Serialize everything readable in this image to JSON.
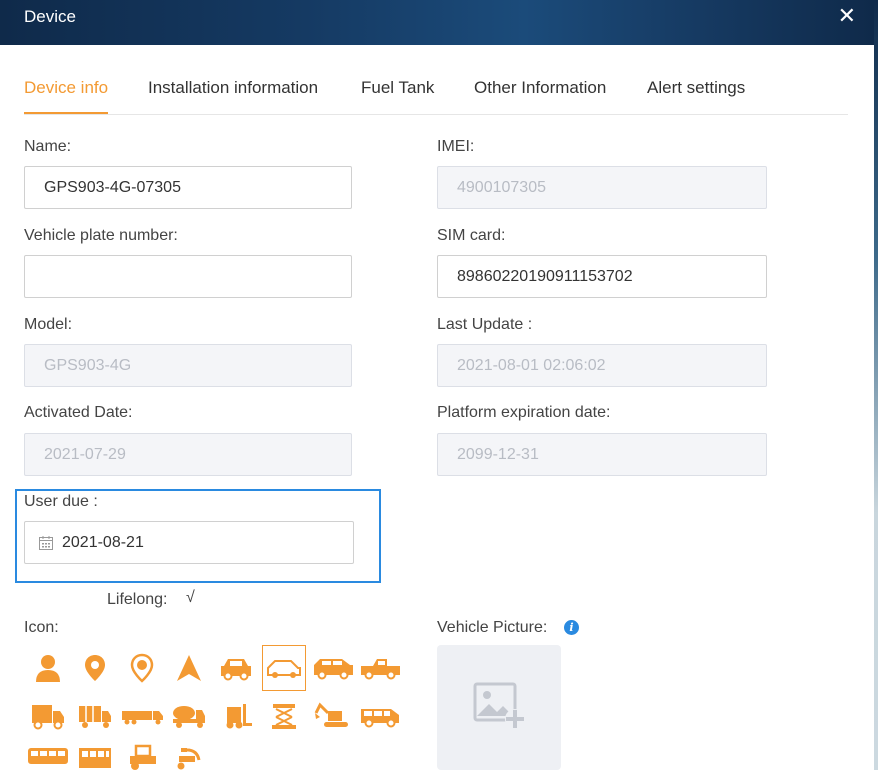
{
  "dialog": {
    "title": "Device"
  },
  "tabs": [
    {
      "label": "Device info"
    },
    {
      "label": "Installation information"
    },
    {
      "label": "Fuel Tank"
    },
    {
      "label": "Other Information"
    },
    {
      "label": "Alert settings"
    }
  ],
  "fields": {
    "name": {
      "label": "Name:",
      "value": "GPS903-4G-07305"
    },
    "imei": {
      "label": "IMEI:",
      "value": "4900107305"
    },
    "plate": {
      "label": "Vehicle plate number:",
      "value": ""
    },
    "sim": {
      "label": "SIM card:",
      "value": "89860220190911153702"
    },
    "model": {
      "label": "Model:",
      "value": "GPS903-4G"
    },
    "last_update": {
      "label": "Last Update :",
      "value": "2021-08-01 02:06:02"
    },
    "activated": {
      "label": "Activated Date:",
      "value": "2021-07-29"
    },
    "platform_exp": {
      "label": "Platform expiration date:",
      "value": "2099-12-31"
    },
    "user_due": {
      "label": "User due :",
      "value": "2021-08-21"
    }
  },
  "lifelong": {
    "label": "Lifelong:",
    "mark": "√"
  },
  "icons": {
    "label": "Icon:",
    "items": [
      "person",
      "location-pin",
      "animal-pin",
      "navigation-arrow",
      "small-car",
      "sedan",
      "suv",
      "pickup-truck",
      "box-truck",
      "cargo-truck",
      "trailer-truck",
      "mixer-truck",
      "forklift",
      "scissor-lift",
      "excavator",
      "van",
      "bus",
      "school-bus",
      "tractor",
      "scooter"
    ],
    "selected": "sedan",
    "color": "#f39a33"
  },
  "vehicle_picture": {
    "label": "Vehicle Picture:",
    "info": "i"
  },
  "colors": {
    "accent": "#f39a33",
    "highlight": "#2a8ae0"
  }
}
